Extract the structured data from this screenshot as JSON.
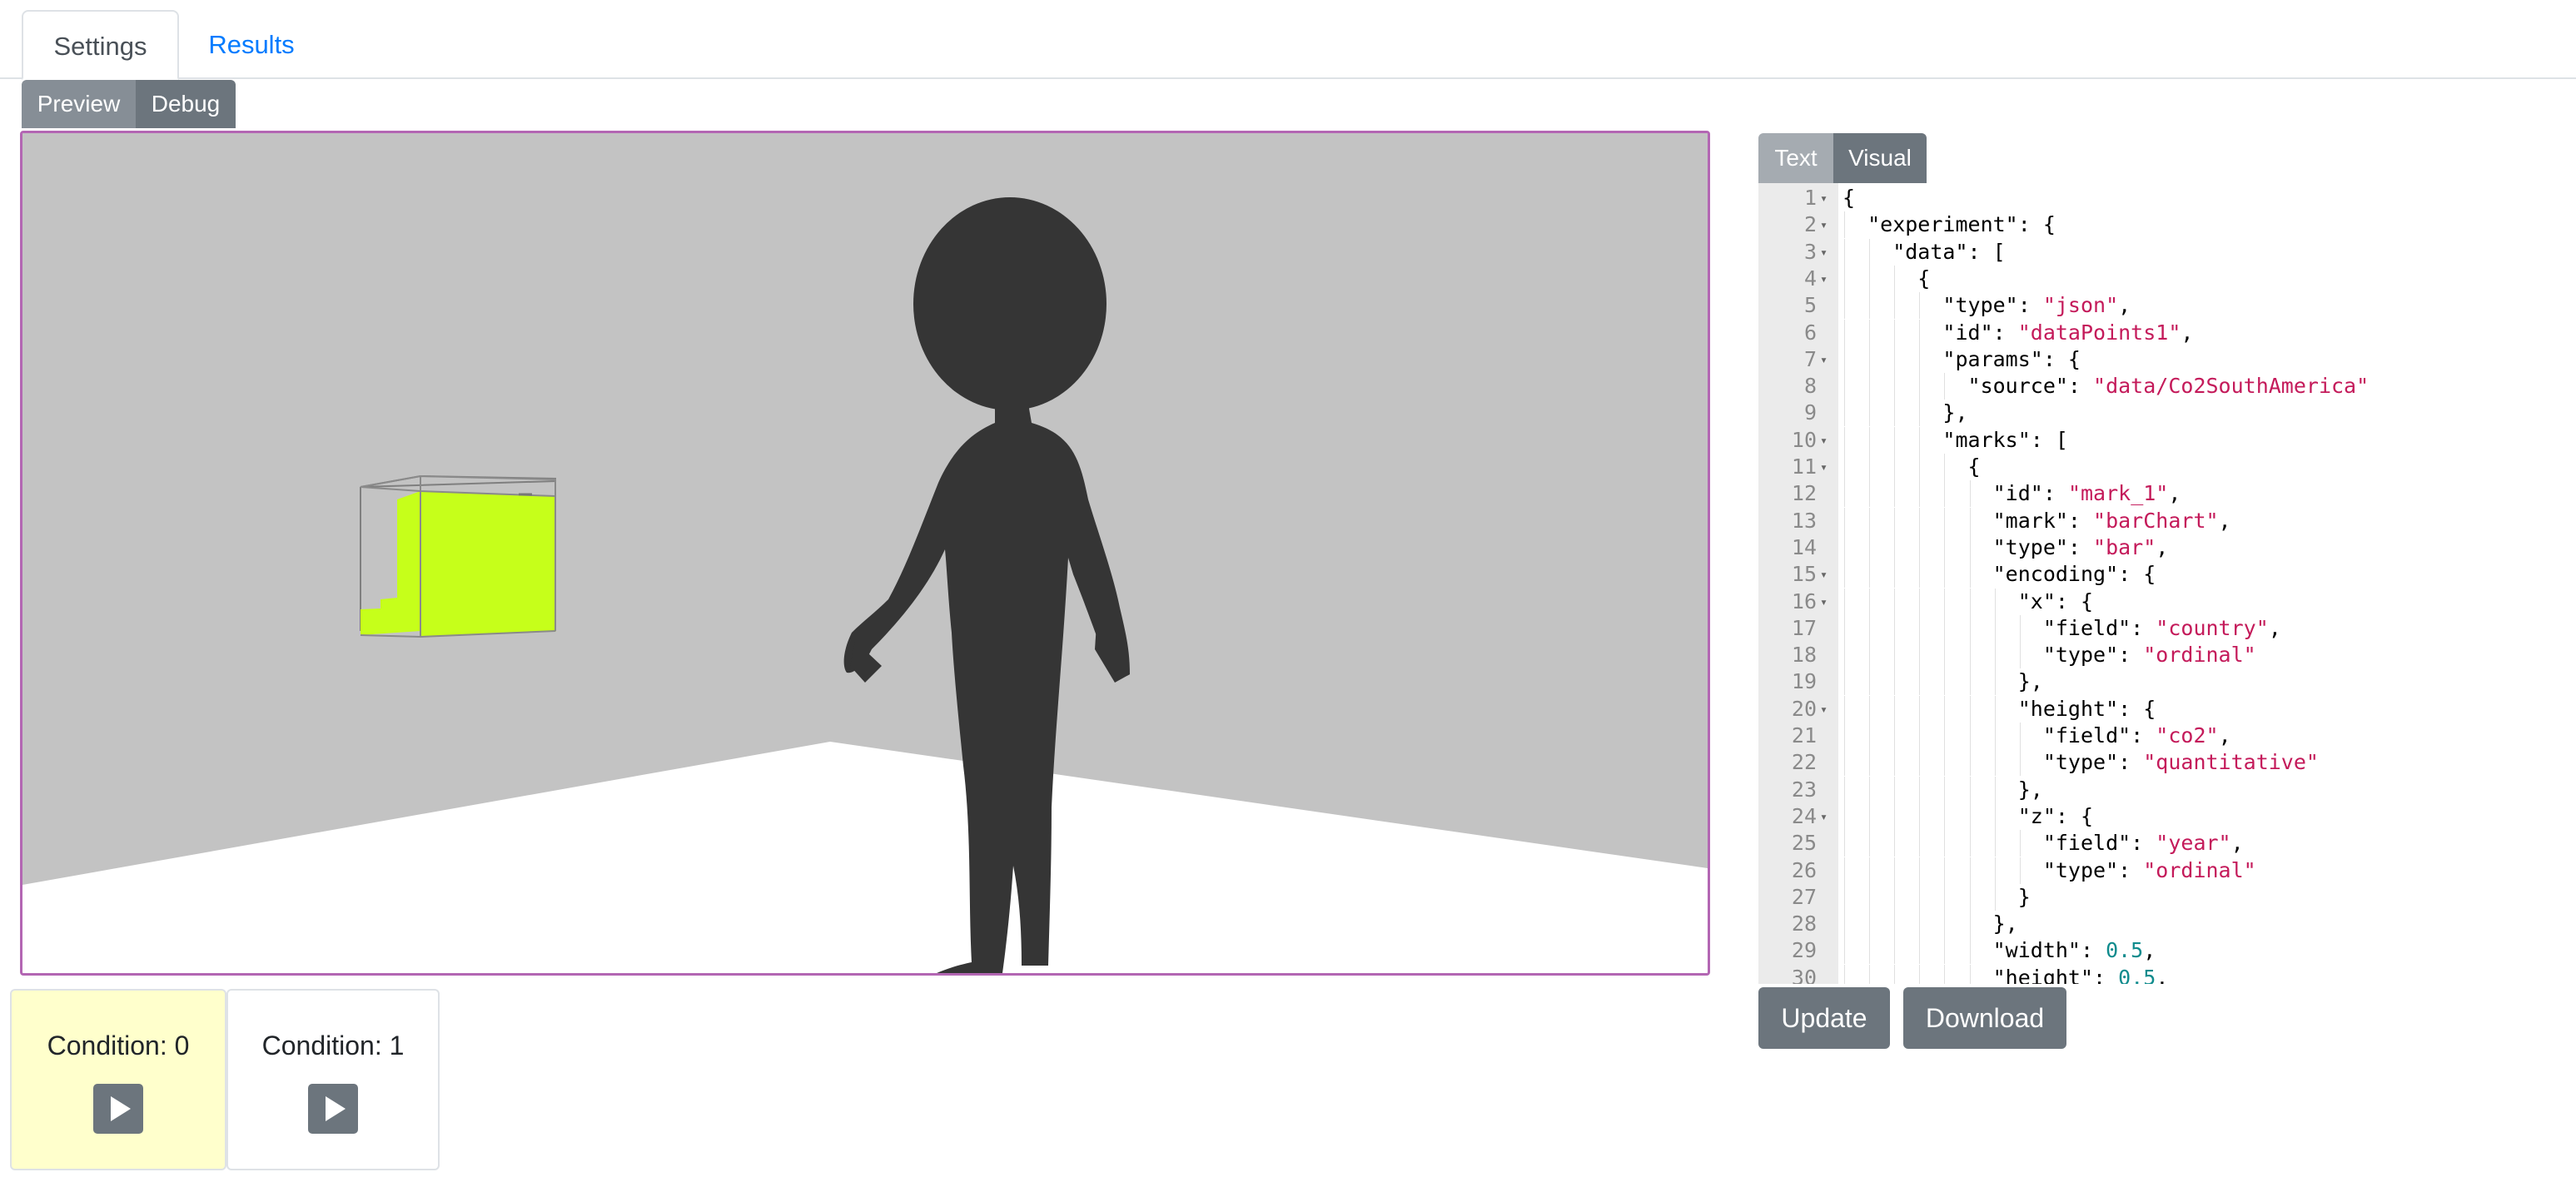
{
  "tabs": {
    "settings": "Settings",
    "results": "Results",
    "active": "Settings"
  },
  "view_toggle": {
    "preview": "Preview",
    "debug": "Debug",
    "active": "Debug"
  },
  "scene": {
    "wall_color": "#c3c3c3",
    "floor_color": "#ffffff",
    "figure_color": "#353535",
    "bar_color": "#c6ff1a",
    "viewport_border": "#b366b3"
  },
  "conditions": [
    {
      "label": "Condition: 0",
      "active": true,
      "bg": "#ffffcc"
    },
    {
      "label": "Condition: 1",
      "active": false,
      "bg": "#ffffff"
    }
  ],
  "editor_toggle": {
    "text": "Text",
    "visual": "Visual",
    "active": "Visual"
  },
  "editor": {
    "lines": [
      {
        "n": "1",
        "fold": true,
        "code": "{"
      },
      {
        "n": "2",
        "fold": true,
        "code": "  \"experiment\": {"
      },
      {
        "n": "3",
        "fold": true,
        "code": "    \"data\": ["
      },
      {
        "n": "4",
        "fold": true,
        "code": "      {"
      },
      {
        "n": "5",
        "fold": false,
        "code": "        \"type\": \"json\","
      },
      {
        "n": "6",
        "fold": false,
        "code": "        \"id\": \"dataPoints1\","
      },
      {
        "n": "7",
        "fold": true,
        "code": "        \"params\": {"
      },
      {
        "n": "8",
        "fold": false,
        "code": "          \"source\": \"data/Co2SouthAmerica\""
      },
      {
        "n": "9",
        "fold": false,
        "code": "        },"
      },
      {
        "n": "10",
        "fold": true,
        "code": "        \"marks\": ["
      },
      {
        "n": "11",
        "fold": true,
        "code": "          {"
      },
      {
        "n": "12",
        "fold": false,
        "code": "            \"id\": \"mark_1\","
      },
      {
        "n": "13",
        "fold": false,
        "code": "            \"mark\": \"barChart\","
      },
      {
        "n": "14",
        "fold": false,
        "code": "            \"type\": \"bar\","
      },
      {
        "n": "15",
        "fold": true,
        "code": "            \"encoding\": {"
      },
      {
        "n": "16",
        "fold": true,
        "code": "              \"x\": {"
      },
      {
        "n": "17",
        "fold": false,
        "code": "                \"field\": \"country\","
      },
      {
        "n": "18",
        "fold": false,
        "code": "                \"type\": \"ordinal\""
      },
      {
        "n": "19",
        "fold": false,
        "code": "              },"
      },
      {
        "n": "20",
        "fold": true,
        "code": "              \"height\": {"
      },
      {
        "n": "21",
        "fold": false,
        "code": "                \"field\": \"co2\","
      },
      {
        "n": "22",
        "fold": false,
        "code": "                \"type\": \"quantitative\""
      },
      {
        "n": "23",
        "fold": false,
        "code": "              },"
      },
      {
        "n": "24",
        "fold": true,
        "code": "              \"z\": {"
      },
      {
        "n": "25",
        "fold": false,
        "code": "                \"field\": \"year\","
      },
      {
        "n": "26",
        "fold": false,
        "code": "                \"type\": \"ordinal\""
      },
      {
        "n": "27",
        "fold": false,
        "code": "              }"
      },
      {
        "n": "28",
        "fold": false,
        "code": "            },"
      },
      {
        "n": "29",
        "fold": false,
        "code": "            \"width\": 0.5,"
      },
      {
        "n": "30",
        "fold": false,
        "code": "            \"height\": 0.5,"
      }
    ]
  },
  "actions": {
    "update": "Update",
    "download": "Download"
  }
}
